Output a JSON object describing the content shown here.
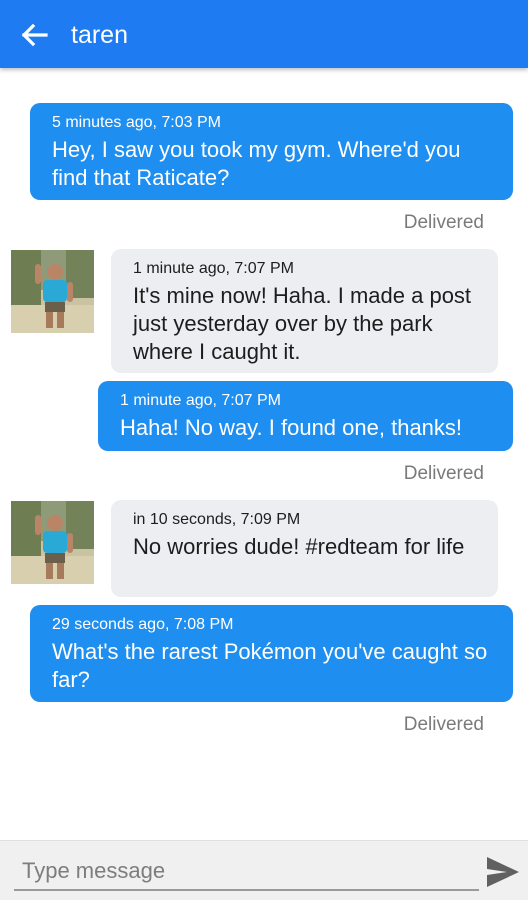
{
  "header": {
    "title": "taren",
    "back_icon": "arrow-left-icon"
  },
  "colors": {
    "header": "#1f7bf2",
    "outgoing_bubble": "#1e8ef0",
    "incoming_bubble": "#eceef1"
  },
  "messages": [
    {
      "direction": "outgoing",
      "meta": "5 minutes ago, 7:03 PM",
      "text": "Hey, I saw you took my gym.  Where'd you find that Raticate?",
      "status": "Delivered"
    },
    {
      "direction": "incoming",
      "meta": "1 minute ago, 7:07 PM",
      "text": "It's mine now!  Haha.  I made a post just yesterday over by the park where I caught it."
    },
    {
      "direction": "outgoing",
      "meta": "1 minute ago, 7:07 PM",
      "text": "Haha!  No way.  I found one, thanks!",
      "status": "Delivered"
    },
    {
      "direction": "incoming",
      "meta": "in 10 seconds, 7:09 PM",
      "text": "No worries dude!  #redteam for life"
    },
    {
      "direction": "outgoing",
      "meta": "29 seconds ago, 7:08 PM",
      "text": "What's the rarest Pokémon you've caught so far?",
      "status": "Delivered"
    }
  ],
  "composer": {
    "placeholder": "Type message",
    "value": "",
    "send_icon": "send-icon"
  }
}
